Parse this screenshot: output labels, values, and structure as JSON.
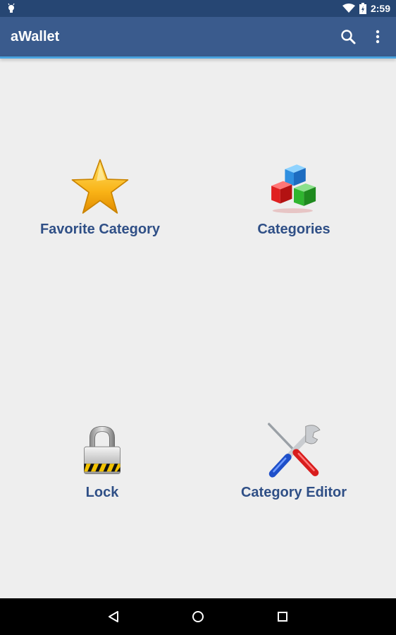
{
  "status_bar": {
    "time": "2:59",
    "icons": [
      "android-debug-icon",
      "wifi-icon",
      "battery-icon"
    ]
  },
  "app_bar": {
    "title": "aWallet",
    "actions": [
      "search-icon",
      "overflow-menu-icon"
    ]
  },
  "tiles": [
    {
      "label": "Favorite Category",
      "icon": "star-icon"
    },
    {
      "label": "Categories",
      "icon": "cubes-icon"
    },
    {
      "label": "Lock",
      "icon": "padlock-icon"
    },
    {
      "label": "Category Editor",
      "icon": "tools-icon"
    }
  ],
  "nav_bar": {
    "buttons": [
      "back-icon",
      "home-icon",
      "recents-icon"
    ]
  },
  "colors": {
    "status_bar": "#264673",
    "app_bar": "#3a5b8d",
    "accent_line": "#4aa3df",
    "label_text": "#2f4f86",
    "background": "#eeeeee"
  }
}
